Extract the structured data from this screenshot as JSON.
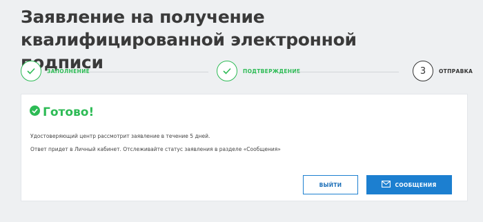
{
  "page": {
    "title": "Заявление на получение квалифицированной электронной подписи"
  },
  "stepper": {
    "steps": [
      {
        "label": "ЗАПОЛНЕНИЕ",
        "status": "done",
        "icon": "check-icon"
      },
      {
        "label": "ПОДТВЕРЖДЕНИЕ",
        "status": "done",
        "icon": "check-icon"
      },
      {
        "label": "ОТПРАВКА",
        "status": "current",
        "number": "3"
      }
    ]
  },
  "card": {
    "heading": "Готово!",
    "heading_icon": "check-circle-icon",
    "message_1": "Удостоверяющий центр рассмотрит заявление в течение 5 дней.",
    "message_2": "Ответ придет в Личный кабинет. Отслеживайте статус заявления в разделе «Сообщения»",
    "exit_button": "ВЫЙТИ",
    "messages_button": "СООБЩЕНИЯ",
    "messages_button_icon": "envelope-icon"
  },
  "colors": {
    "success": "#2dbb55",
    "primary": "#1c7fd0",
    "background": "#eef0f2"
  }
}
